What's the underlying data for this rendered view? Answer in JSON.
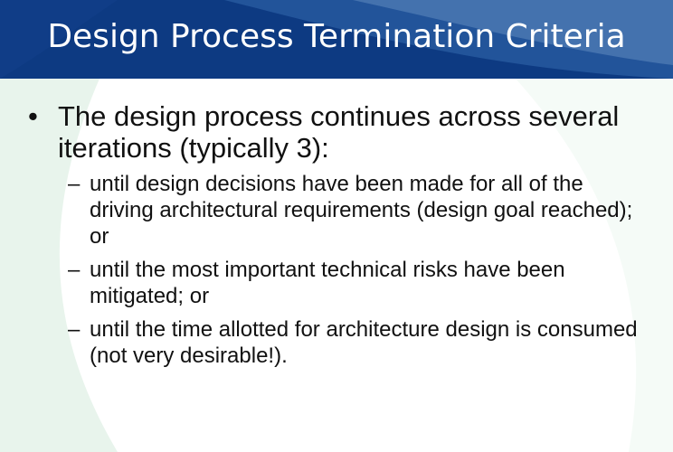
{
  "slide": {
    "title": "Design Process Termination Criteria",
    "bullets": [
      {
        "marker": "•",
        "text": "The design process continues across several iterations (typically 3):",
        "subitems": [
          {
            "marker": "–",
            "text": "until design decisions have been made for all of the driving architectural requirements (design goal reached); or"
          },
          {
            "marker": "–",
            "text": "until the most important technical risks have been mitigated; or"
          },
          {
            "marker": "–",
            "text": "until the time allotted for architecture design is consumed (not very desirable!)."
          }
        ]
      }
    ]
  },
  "colors": {
    "header_blue": "#0d3a82",
    "swoosh_blue": "#4f78b4",
    "swoosh_green": "#e8f4ec",
    "text": "#111111",
    "background": "#ffffff"
  }
}
